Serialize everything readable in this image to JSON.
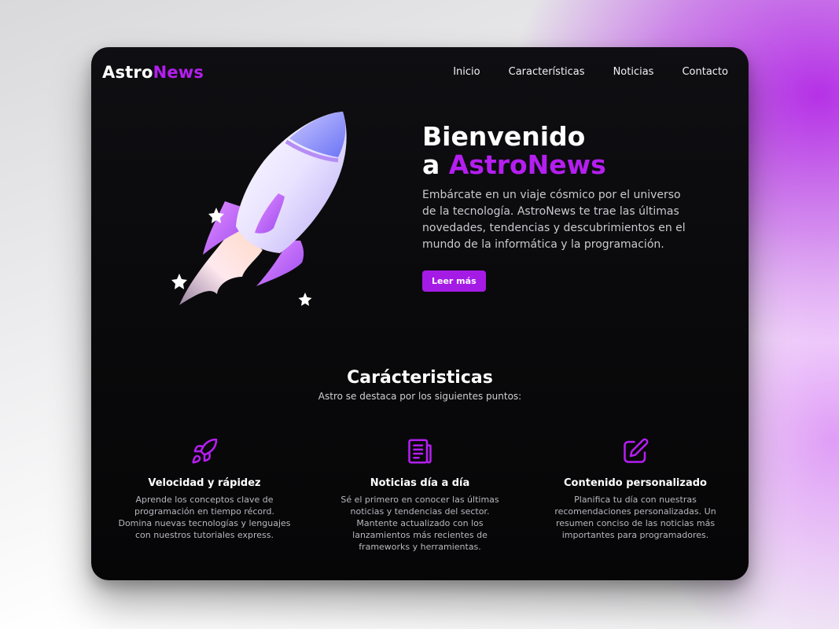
{
  "brand": {
    "prefix": "Astro",
    "accent": "News",
    "accent_color": "#b51ef0"
  },
  "nav": {
    "items": [
      {
        "label": "Inicio"
      },
      {
        "label": "Características"
      },
      {
        "label": "Noticias"
      },
      {
        "label": "Contacto"
      }
    ]
  },
  "hero": {
    "title_line1": "Bienvenido",
    "title_line2_prefix": "a ",
    "title_line2_accent": "AstroNews",
    "description": "Embárcate en un viaje cósmico por el universo de la tecnología. AstroNews te trae las últimas novedades, tendencias y descubrimientos en el mundo de la informática y la programación.",
    "cta_label": "Leer más",
    "cta_color": "#a51be6",
    "image_icon": "rocket-illustration"
  },
  "features": {
    "title": "Carácteristicas",
    "subtitle": "Astro se destaca por los siguientes puntos:",
    "items": [
      {
        "icon": "rocket-icon",
        "title": "Velocidad y rápidez",
        "text": "Aprende los conceptos clave de programación en tiempo récord. Domina nuevas tecnologías y lenguajes con nuestros tutoriales express."
      },
      {
        "icon": "newspaper-icon",
        "title": "Noticias día a día",
        "text": "Sé el primero en conocer las últimas noticias y tendencias del sector. Mantente actualizado con los lanzamientos más recientes de frameworks y herramientas."
      },
      {
        "icon": "edit-icon",
        "title": "Contenido personalizado",
        "text": "Planifica tu día con nuestras recomendaciones personalizadas. Un resumen conciso de las noticias más importantes para programadores."
      }
    ]
  }
}
